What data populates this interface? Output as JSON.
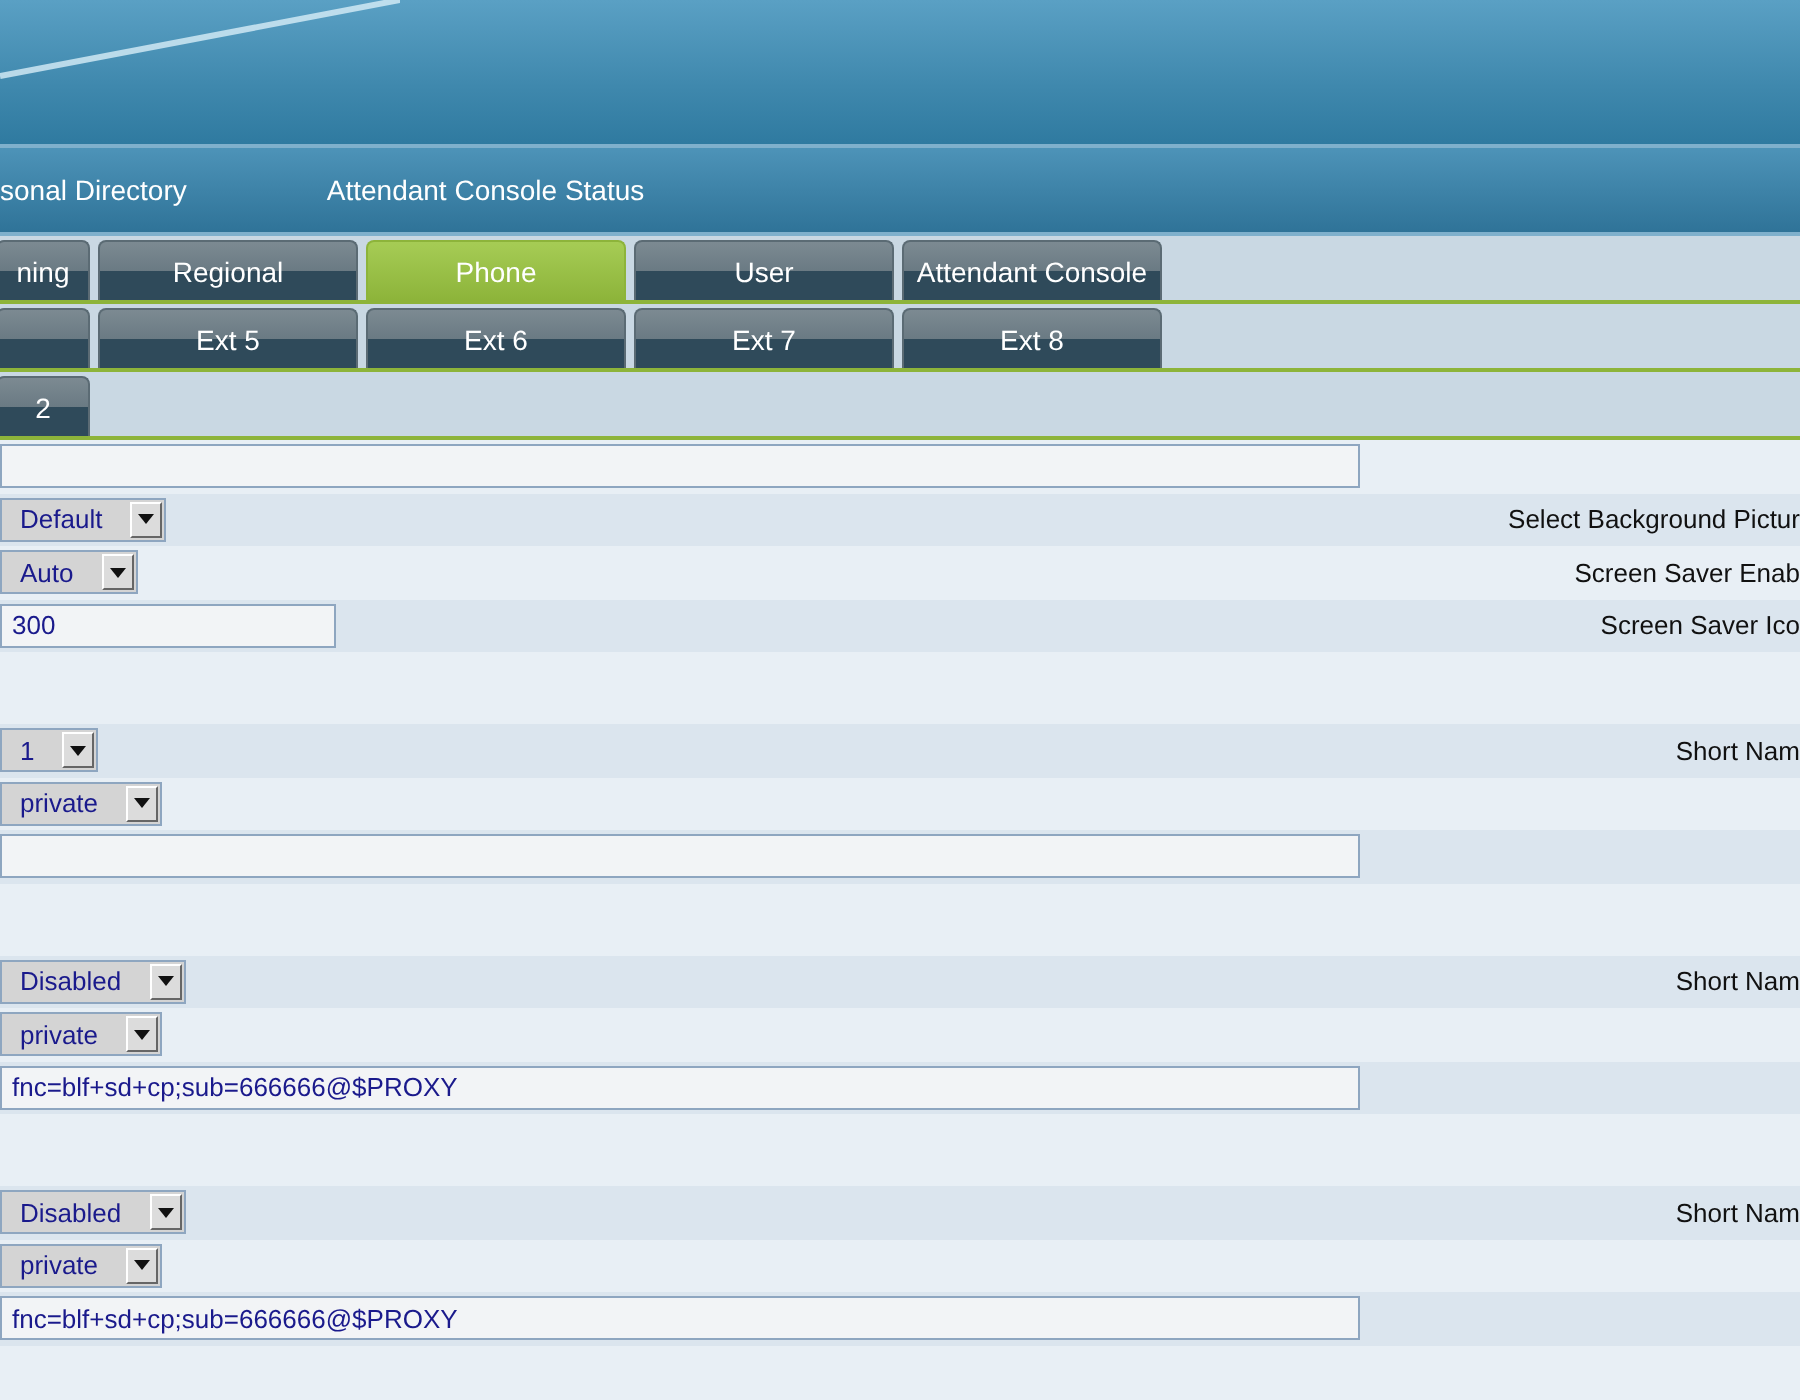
{
  "nav_links": [
    {
      "label": "sonal Directory"
    },
    {
      "label": "Attendant Console Status"
    }
  ],
  "tab_rows": [
    {
      "tabs": [
        {
          "label": "ning",
          "selected": false
        },
        {
          "label": "Regional",
          "selected": false
        },
        {
          "label": "Phone",
          "selected": true
        },
        {
          "label": "User",
          "selected": false
        },
        {
          "label": "Attendant Console",
          "selected": false
        }
      ]
    },
    {
      "tabs": [
        {
          "selected": false
        },
        {
          "label": "Ext 5",
          "selected": false
        },
        {
          "label": "Ext 6",
          "selected": false
        },
        {
          "label": "Ext 7",
          "selected": false
        },
        {
          "label": "Ext 8",
          "selected": false
        }
      ]
    },
    {
      "tabs": [
        {
          "label": "2",
          "selected": false
        }
      ]
    }
  ],
  "form_rows": [
    {
      "kind": "text",
      "value": ""
    },
    {
      "kind": "select",
      "value": "Default",
      "label": "Select Background Pictur"
    },
    {
      "kind": "select",
      "value": "Auto",
      "label": "Screen Saver Enab"
    },
    {
      "kind": "number",
      "value": "300",
      "label": "Screen Saver Ico"
    },
    {
      "kind": "blank"
    },
    {
      "kind": "select",
      "value": "1",
      "label": "Short Nam"
    },
    {
      "kind": "select",
      "value": "private"
    },
    {
      "kind": "text",
      "value": ""
    },
    {
      "kind": "blank"
    },
    {
      "kind": "select",
      "value": "Disabled",
      "label": "Short Nam"
    },
    {
      "kind": "select",
      "value": "private"
    },
    {
      "kind": "text",
      "value": "fnc=blf+sd+cp;sub=666666@$PROXY"
    },
    {
      "kind": "blank"
    },
    {
      "kind": "select",
      "value": "Disabled",
      "label": "Short Nam"
    },
    {
      "kind": "select",
      "value": "private"
    },
    {
      "kind": "text",
      "value": "fnc=blf+sd+cp;sub=666666@$PROXY"
    },
    {
      "kind": "blank"
    }
  ]
}
